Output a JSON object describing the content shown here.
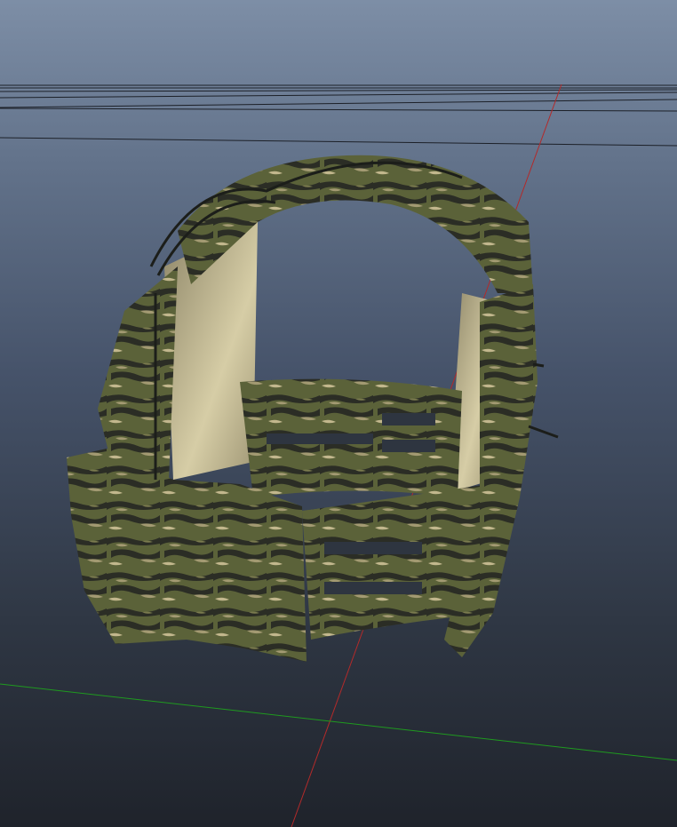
{
  "viewport": {
    "background_top": "#7d8ea6",
    "background_bottom": "#1f232b",
    "grid_color": "#1c2028",
    "x_axis_color": "#b22a2a",
    "z_axis_color": "#1f9a1f"
  },
  "model": {
    "name": "camo-plate-carrier",
    "camo_colors": [
      "#2b2d25",
      "#5b6239",
      "#a39a72",
      "#3e4430",
      "#7a7a4e"
    ],
    "interior_color": "#c9bf98"
  }
}
